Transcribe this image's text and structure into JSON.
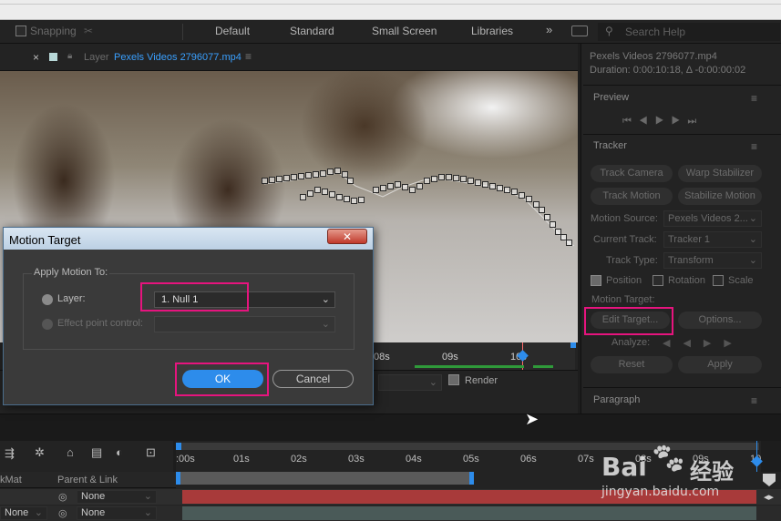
{
  "toolbar": {
    "snapping_label": "Snapping",
    "workspaces": [
      "Default",
      "Standard",
      "Small Screen",
      "Libraries"
    ],
    "more_glyph": "»",
    "search_placeholder": "Search Help"
  },
  "comp_tab": {
    "close_glyph": "×",
    "layer_prefix": "Layer",
    "layer_name": "Pexels Videos 2796077.mp4"
  },
  "timebar": {
    "ticks": [
      "08s",
      "09s",
      "10s"
    ]
  },
  "render_label": "Render",
  "info": {
    "filename": "Pexels Videos 2796077.mp4",
    "duration": "Duration: 0:00:10:18, Δ -0:00:00:02"
  },
  "preview": {
    "title": "Preview"
  },
  "tracker": {
    "title": "Tracker",
    "track_camera": "Track Camera",
    "warp_stabilizer": "Warp Stabilizer",
    "track_motion": "Track Motion",
    "stabilize_motion": "Stabilize Motion",
    "motion_source_label": "Motion Source:",
    "motion_source_value": "Pexels Videos 2...",
    "current_track_label": "Current Track:",
    "current_track_value": "Tracker 1",
    "track_type_label": "Track Type:",
    "track_type_value": "Transform",
    "position_label": "Position",
    "rotation_label": "Rotation",
    "scale_label": "Scale",
    "motion_target_label": "Motion Target:",
    "edit_target": "Edit Target...",
    "options": "Options...",
    "analyze_label": "Analyze:",
    "reset": "Reset",
    "apply": "Apply"
  },
  "paragraph": {
    "title": "Paragraph"
  },
  "timeline": {
    "ticks": [
      ":00s",
      "01s",
      "02s",
      "03s",
      "04s",
      "05s",
      "06s",
      "07s",
      "08s",
      "09s",
      "10"
    ],
    "col_trkmat": "kMat",
    "col_parent": "Parent & Link",
    "row1_parent": "None",
    "row2_trkmat": "None",
    "row2_parent": "None"
  },
  "dialog": {
    "title": "Motion Target",
    "close_glyph": "✕",
    "group_label": "Apply Motion To:",
    "layer_label": "Layer:",
    "layer_value": "1. Null 1",
    "effect_label": "Effect point control:",
    "ok": "OK",
    "cancel": "Cancel"
  },
  "watermark": {
    "brand": "Bai",
    "brand2": "百",
    "brand3": "经验",
    "url": "jingyan.baidu.com"
  },
  "colors": {
    "highlight": "#e6147e",
    "ok_blue": "#2d8ceb",
    "timeline_red": "#a83a3a",
    "timeline_green": "#2f9a3a"
  }
}
